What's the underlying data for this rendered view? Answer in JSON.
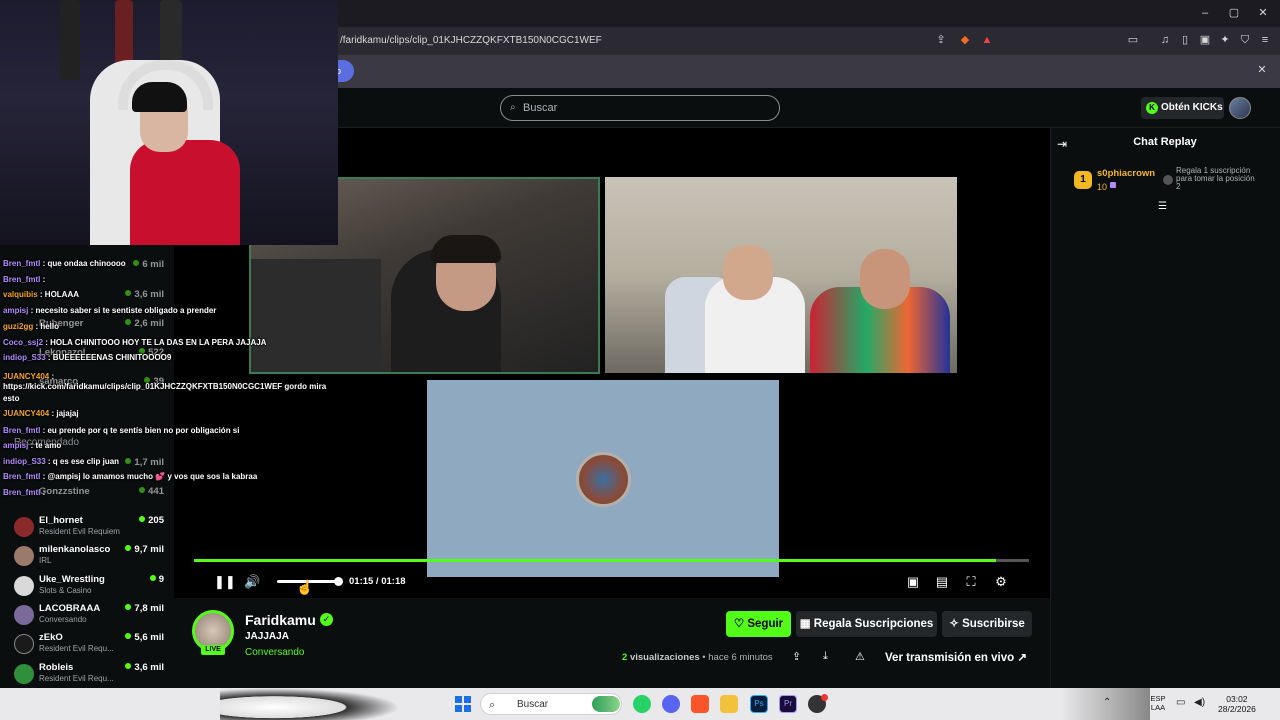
{
  "browser": {
    "url": "/faridkamu/clips/clip_01KJHCZZQKFXTB150N0CGC1WEF",
    "notif_partial": "o"
  },
  "header": {
    "search_placeholder": "Buscar",
    "get_kicks": "Obtén KICKs"
  },
  "player": {
    "time": "01:15 / 01:18",
    "progress": 0.96,
    "volume": 1.0
  },
  "chat_replay": {
    "title": "Chat Replay",
    "rank": "1",
    "user": "s0phiacrown",
    "count": "10",
    "gift_text": "Regala 1 suscripción para tomar la posición 2"
  },
  "channel": {
    "name": "Faridkamu",
    "title": "JAJJAJA",
    "category": "Conversando",
    "live": "LIVE",
    "follow": "Seguir",
    "gift_subs": "Regala Suscripciones",
    "subscribe": "Suscribirse",
    "views_count": "2",
    "views_label": "visualizaciones",
    "time_ago": "• hace 6 minutos",
    "watch_stream": "Ver transmisión en vivo"
  },
  "overlay_chat": [
    {
      "name": "Bren_fmtl",
      "text": " : que ondaa chinoooo",
      "color": "purple"
    },
    {
      "name": "Bren_fmtl",
      "text": " :",
      "color": "purple"
    },
    {
      "name": "valquibis",
      "text": " : HOLAAA",
      "color": "orange"
    },
    {
      "name": "ampisj",
      "text": " : necesito saber si te sentiste obligado a prender",
      "color": "purple"
    },
    {
      "name": "guzi2gg",
      "text": " : hello",
      "color": "orange"
    },
    {
      "name": "Coco_ssj2",
      "text": " : HOLA CHINITOOO HOY TE LA DAS EN LA PERA JAJAJA",
      "color": "purple"
    },
    {
      "name": "indiop_S33",
      "text": " : BUEEEEEENAS CHINITOOOO9",
      "color": "purple"
    },
    {
      "name": "JUANCY404",
      "text": " :",
      "color": "orange"
    },
    {
      "name": "",
      "text": "https://kick.com/faridkamu/clips/clip_01KJHCZZQKFXTB150N0CGC1WEF gordo mira",
      "color": "white"
    },
    {
      "name": "",
      "text": "esto",
      "color": "white"
    },
    {
      "name": "JUANCY404",
      "text": " : jajajaj",
      "color": "orange"
    },
    {
      "name": "Bren_fmtl",
      "text": " : eu prende por q te sentís bien no por obligación si",
      "color": "purple"
    },
    {
      "name": "ampisj",
      "text": " : te amo",
      "color": "purple"
    },
    {
      "name": "indiop_S33",
      "text": " : q es ese clip juan",
      "color": "purple"
    },
    {
      "name": "Bren_fmtl",
      "text": " : @ampisj lo amamos mucho 💕 y vos que sos la kabraa",
      "color": "purple"
    },
    {
      "name": "Bren_fmtl",
      "text": " :",
      "color": "purple"
    }
  ],
  "sidebar": {
    "recommended_label": "Recomendado",
    "channels": [
      {
        "name": "El_hornet",
        "category": "Resident Evil Requiem",
        "viewers": "205"
      },
      {
        "name": "milenkanolasco",
        "category": "IRL",
        "viewers": "9,7 mil"
      },
      {
        "name": "Uke_Wrestling",
        "category": "Slots & Casino",
        "viewers": "9"
      },
      {
        "name": "LACOBRAAA",
        "category": "Conversando",
        "viewers": "7,8 mil"
      },
      {
        "name": "zEkO",
        "category": "Resident Evil Requ...",
        "viewers": "5,6 mil"
      },
      {
        "name": "Robleis",
        "category": "Resident Evil Requ...",
        "viewers": "3,6 mil"
      }
    ],
    "faded": [
      {
        "name": "",
        "viewers": "6 mil"
      },
      {
        "name": "",
        "viewers": "3,6 mil"
      },
      {
        "name": "Rubenger",
        "viewers": "2,6 mil"
      },
      {
        "name": "Lekonazol",
        "viewers": "522"
      },
      {
        "name": "samarco",
        "viewers": "39"
      },
      {
        "name": "",
        "viewers": "1,7 mil"
      },
      {
        "name": "Gonzzstine",
        "viewers": "441"
      }
    ]
  },
  "taskbar": {
    "search": "Buscar",
    "lang": "ESP LAA",
    "time": "03:02",
    "date": "28/2/2026"
  }
}
